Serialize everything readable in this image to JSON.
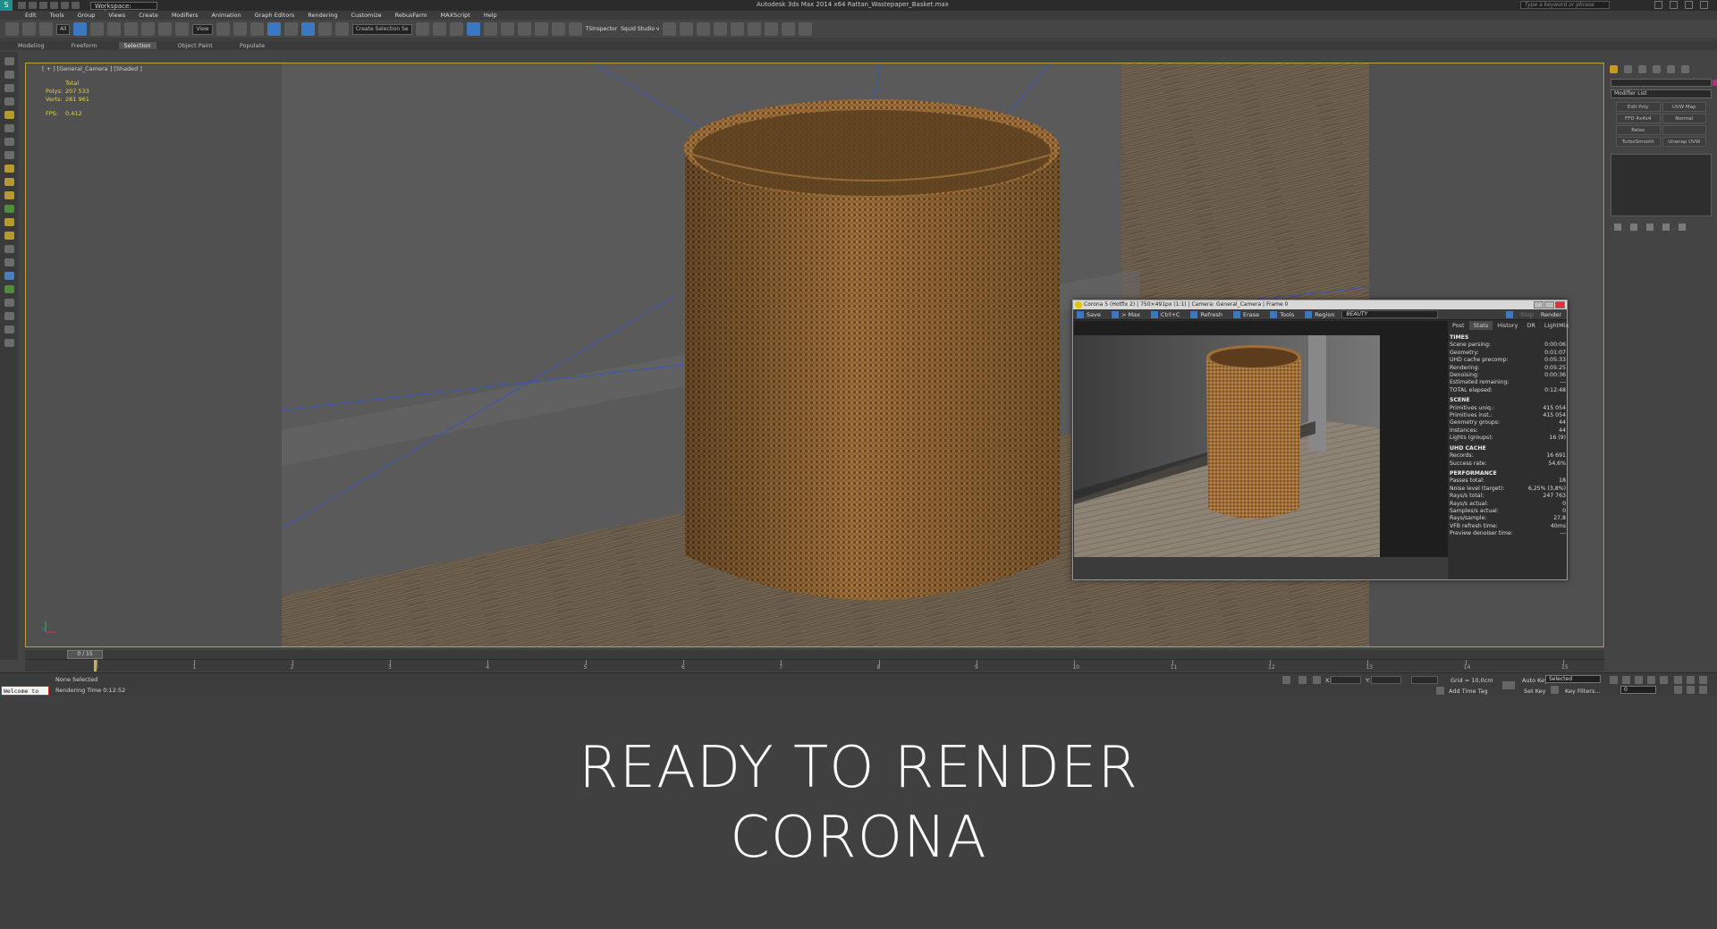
{
  "titlebar": {
    "workspace": "Workspace: Default",
    "title": "Autodesk 3ds Max 2014 x64    Rattan_Wastepaper_Basket.max",
    "search_placeholder": "Type a keyword or phrase"
  },
  "menu": [
    "Edit",
    "Tools",
    "Group",
    "Views",
    "Create",
    "Modifiers",
    "Animation",
    "Graph Editors",
    "Rendering",
    "Customize",
    "RebusFarm",
    "MAXScript",
    "Help"
  ],
  "toolbar": {
    "filter": "All",
    "ref_coord": "View",
    "named_sel": "Create Selection Se",
    "tsinspector": "TSInspector",
    "squid": "Squid Studio v"
  },
  "ribbon": {
    "tabs": [
      "Modeling",
      "Freeform",
      "Selection",
      "Object Paint",
      "Populate"
    ],
    "active": "Selection"
  },
  "viewport": {
    "label": "[ + ] [General_Camera ] [Shaded ]",
    "stats": {
      "header": "Total",
      "polys_label": "Polys:",
      "polys": "207 533",
      "verts_label": "Verts:",
      "verts": "281 961",
      "fps_label": "FPS:",
      "fps": "0,412"
    }
  },
  "command_panel": {
    "modifier_list": "Modifier List",
    "buttons": [
      "Edit Poly",
      "UVW Map",
      "FFD 4x4x4",
      "Normal",
      "Relax",
      "",
      "TurboSmooth",
      "Unwrap UVW"
    ]
  },
  "timeline": {
    "frame": "0 / 15",
    "ticks": [
      "0",
      "1",
      "2",
      "3",
      "4",
      "5",
      "6",
      "7",
      "8",
      "9",
      "10",
      "11",
      "12",
      "13",
      "14",
      "15"
    ]
  },
  "statusbar": {
    "maxscript": "Welcome to",
    "selection": "None Selected",
    "render_time": "Rendering Time  0:12:52",
    "x_label": "X:",
    "y_label": "Y:",
    "grid": "Grid = 10,0cm",
    "add_time_tag": "Add Time Tag",
    "auto_key": "Auto Key",
    "auto_key_sel": "Selected",
    "set_key": "Set Key",
    "key_filters": "Key Filters...",
    "frame": "0"
  },
  "vfb": {
    "title": "Corona 5 (Hotfix 2) | 750×491px (1:1) | Camera: General_Camera | Frame 0",
    "tools": [
      "Save",
      "> Max",
      "Ctrl+C",
      "Refresh",
      "Erase",
      "Tools",
      "Region"
    ],
    "channel": "BEAUTY",
    "stop": "Stop",
    "render": "Render",
    "tabs": [
      "Post",
      "Stats",
      "History",
      "DR",
      "LightMix"
    ],
    "active_tab": "Stats",
    "sections": [
      {
        "title": "TIMES",
        "rows": [
          [
            "Scene parsing:",
            "0:00:06"
          ],
          [
            "Geometry:",
            "0:01:07"
          ],
          [
            "UHD cache precomp:",
            "0:05:33"
          ],
          [
            "Rendering:",
            "0:05:25"
          ],
          [
            "Denoising:",
            "0:00:36"
          ],
          [
            "Estimated remaining:",
            "---"
          ],
          [
            "TOTAL elapsed:",
            "0:12:48"
          ]
        ]
      },
      {
        "title": "SCENE",
        "rows": [
          [
            "Primitives uniq.:",
            "415 054"
          ],
          [
            "Primitives inst.:",
            "415 054"
          ],
          [
            "Geometry groups:",
            "44"
          ],
          [
            "Instances:",
            "44"
          ],
          [
            "Lights (groups):",
            "16 (9)"
          ]
        ]
      },
      {
        "title": "UHD CACHE",
        "rows": [
          [
            "Records:",
            "16 691"
          ],
          [
            "Success rate:",
            "54,6%"
          ]
        ]
      },
      {
        "title": "PERFORMANCE",
        "rows": [
          [
            "Passes total:",
            "18"
          ],
          [
            "Noise level (target):",
            "6,25% (3,8%)"
          ],
          [
            "Rays/s total:",
            "247 763"
          ],
          [
            "Rays/s actual:",
            "0"
          ],
          [
            "Samples/s actual:",
            "0"
          ],
          [
            "Rays/sample:",
            "27,8"
          ],
          [
            "VFB refresh time:",
            "40ms"
          ],
          [
            "Preview denoiser time:",
            "---"
          ]
        ]
      }
    ]
  },
  "caption": {
    "line1": "READY TO RENDER",
    "line2": "CORONA"
  }
}
